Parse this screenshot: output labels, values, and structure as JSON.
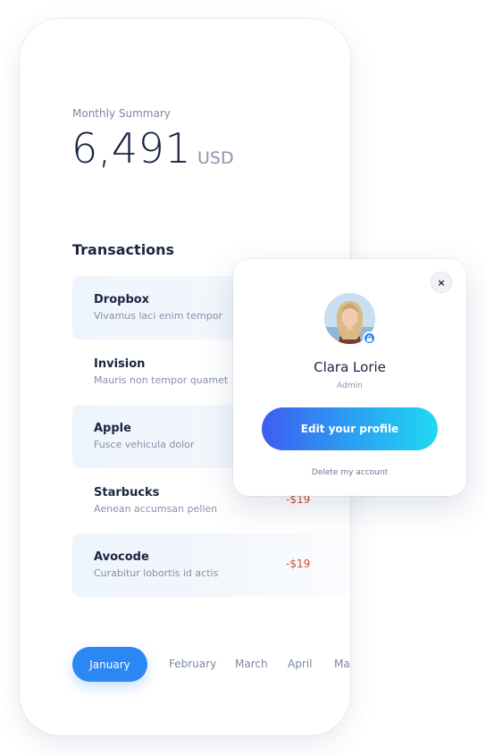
{
  "summary": {
    "label": "Monthly Summary",
    "amount": "6,491",
    "currency": "USD"
  },
  "transactions": {
    "title": "Transactions",
    "items": [
      {
        "name": "Dropbox",
        "description": "Vivamus laci enim tempor",
        "amount": ""
      },
      {
        "name": "Invision",
        "description": "Mauris non tempor quamet",
        "amount": ""
      },
      {
        "name": "Apple",
        "description": "Fusce vehicula dolor",
        "amount": ""
      },
      {
        "name": "Starbucks",
        "description": "Aenean accumsan pellen",
        "amount": "-$19"
      },
      {
        "name": "Avocode",
        "description": "Curabitur lobortis id actis",
        "amount": "-$19"
      }
    ]
  },
  "months": {
    "active": "January",
    "others": [
      "February",
      "March",
      "April",
      "Ma"
    ]
  },
  "profile_card": {
    "close_icon": "close-icon",
    "close_label": "×",
    "name": "Clara Lorie",
    "role": "Admin",
    "edit_label": "Edit your profile",
    "delete_label": "Delete my account",
    "lock_icon": "lock-icon"
  },
  "colors": {
    "accent_blue": "#2b87f4",
    "negative_amount": "#d4502e",
    "gradient_start": "#3e5cf3",
    "gradient_end": "#1fd9f2",
    "text_dark": "#1d2440"
  }
}
